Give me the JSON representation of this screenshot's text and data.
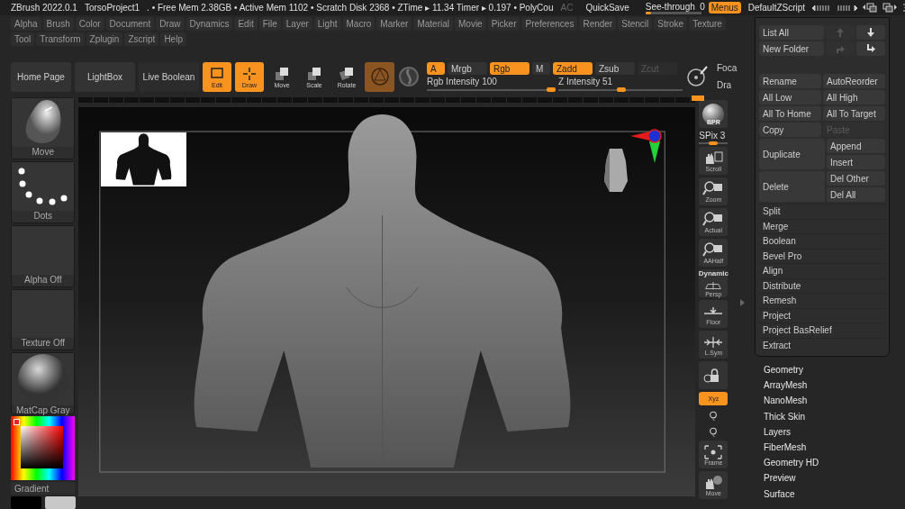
{
  "title_bar": {
    "app_name": "ZBrush 2022.0.1",
    "project": "TorsoProject1",
    "stats": ". • Free Mem 2.38GB • Active Mem 1102 • Scratch Disk 2368 •  ZTime ▸ 11.34 Timer ▸ 0.197 • PolyCou",
    "ac": "AC",
    "quicksave": "QuickSave",
    "see_through": {
      "label": "See-through",
      "value": "0",
      "level": 0.1
    },
    "menus": {
      "label": "Menus",
      "on": true
    },
    "script": "DefaultZScript"
  },
  "menu_rows": [
    [
      "Alpha",
      "Brush",
      "Color",
      "Document",
      "Draw",
      "Dynamics",
      "Edit",
      "File",
      "Layer",
      "Light",
      "Macro",
      "Marker",
      "Material",
      "Movie",
      "Picker",
      "Preferences",
      "Render",
      "Stencil",
      "Stroke",
      "Texture"
    ],
    [
      "Tool",
      "Transform",
      "Zplugin",
      "Zscript",
      "Help"
    ]
  ],
  "toolbar": {
    "shortcuts": [
      "Home Page",
      "LightBox",
      "Live Boolean"
    ],
    "tools": [
      {
        "kind": "edit",
        "label": "Edit",
        "on": true
      },
      {
        "kind": "draw",
        "label": "Draw",
        "on": true
      },
      {
        "kind": "move",
        "label": "Move",
        "on": false
      },
      {
        "kind": "scale",
        "label": "Scale",
        "on": false
      },
      {
        "kind": "rotate",
        "label": "Rotate",
        "on": false
      }
    ],
    "modes": [
      {
        "label": "A",
        "on": true,
        "disabled": false
      },
      {
        "label": "Mrgb",
        "on": false,
        "disabled": false
      },
      {
        "label": "Rgb",
        "on": true,
        "disabled": false
      },
      {
        "label": "M",
        "on": false,
        "disabled": false
      },
      {
        "label": "Zadd",
        "on": true,
        "disabled": false
      },
      {
        "label": "Zsub",
        "on": false,
        "disabled": false
      },
      {
        "label": "Zcut",
        "on": false,
        "disabled": true
      }
    ],
    "sliders": [
      {
        "label": "Rgb Intensity 100",
        "level": 1
      },
      {
        "label": "Z Intensity 51",
        "level": 0.51
      }
    ],
    "edge": [
      "Foca",
      "Dra"
    ]
  },
  "left_shelf": {
    "tiles": [
      {
        "kind": "brush",
        "label": "Move"
      },
      {
        "kind": "stroke",
        "label": "Dots"
      },
      {
        "kind": "empty",
        "label": "Alpha Off"
      },
      {
        "kind": "empty",
        "label": "Texture Off"
      },
      {
        "kind": "material",
        "label": "MatCap Gray"
      }
    ],
    "gradient": "Gradient",
    "swatches": [
      {
        "color": "#000000"
      },
      {
        "color": "#c8c8c8"
      }
    ]
  },
  "right_shelf": {
    "items": [
      {
        "kind": "bpr",
        "label": "BPR",
        "on": false
      },
      {
        "kind": "spix",
        "label": "SPix 3",
        "level": 0.5
      },
      {
        "kind": "scroll",
        "label": "Scroll",
        "on": false
      },
      {
        "kind": "zoom",
        "label": "Zoom",
        "on": false
      },
      {
        "kind": "actual",
        "label": "Actual",
        "on": false
      },
      {
        "kind": "aahalf",
        "label": "AAHalf",
        "on": false
      },
      {
        "kind": "persp",
        "top_label": "Dynamic",
        "label": "Persp",
        "on": false
      },
      {
        "kind": "floor",
        "label": "Floor",
        "on": false
      },
      {
        "kind": "lsym",
        "label": "L.Sym",
        "on": false
      },
      {
        "kind": "lock",
        "on": false
      },
      {
        "kind": "xyz",
        "label": "Xyz",
        "on": true
      },
      {
        "kind": "rot_y"
      },
      {
        "kind": "rot_z"
      },
      {
        "kind": "frame",
        "label": "Frame",
        "on": false
      },
      {
        "kind": "move",
        "label": "Move",
        "on": false
      }
    ]
  },
  "subtool_panel": {
    "rows": [
      [
        {
          "kind": "text",
          "label": "List All",
          "disabled": false
        },
        {
          "kind": "up",
          "disabled": true
        },
        {
          "kind": "down",
          "disabled": false
        }
      ],
      [
        {
          "kind": "text",
          "label": "New Folder",
          "disabled": false
        },
        {
          "kind": "redo",
          "disabled": true
        },
        {
          "kind": "down_right",
          "disabled": false
        }
      ],
      [
        {
          "kind": "text",
          "label": "Rename",
          "disabled": false
        },
        {
          "kind": "text",
          "label": "AutoReorder",
          "disabled": false
        }
      ],
      [
        {
          "kind": "text",
          "label": "All Low",
          "disabled": false
        },
        {
          "kind": "text",
          "label": "All High",
          "disabled": false
        }
      ],
      [
        {
          "kind": "text",
          "label": "All To Home",
          "disabled": false
        },
        {
          "kind": "text",
          "label": "All To Target",
          "disabled": false
        }
      ],
      [
        {
          "kind": "text",
          "label": "Copy",
          "disabled": false
        },
        {
          "kind": "text",
          "label": "Paste",
          "disabled": true
        }
      ]
    ],
    "pairs": [
      {
        "label": "Duplicate",
        "subs": [
          "Append",
          "Insert"
        ]
      },
      {
        "label": "Delete",
        "subs": [
          "Del Other",
          "Del All"
        ]
      }
    ],
    "list": [
      "Split",
      "Merge",
      "Boolean",
      "Bevel Pro",
      "Align",
      "Distribute",
      "Remesh",
      "Project",
      "Project BasRelief",
      "Extract"
    ]
  },
  "palettes": [
    "Geometry",
    "ArrayMesh",
    "NanoMesh",
    "Thick Skin",
    "Layers",
    "FiberMesh",
    "Geometry HD",
    "Preview",
    "Surface"
  ]
}
